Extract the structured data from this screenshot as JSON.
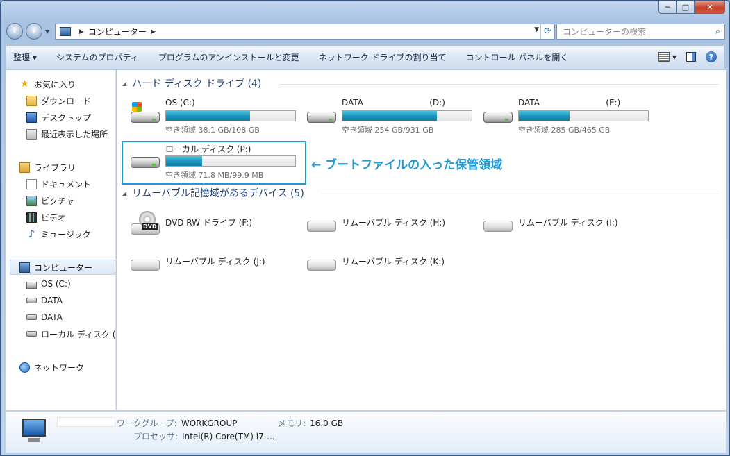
{
  "titlebar": {
    "min": "─",
    "max": "□",
    "close": "✕"
  },
  "address": {
    "crumb": "コンピューター",
    "search_placeholder": "コンピューターの検索"
  },
  "toolbar": {
    "items": [
      "整理 ▾",
      "システムのプロパティ",
      "プログラムのアンインストールと変更",
      "ネットワーク ドライブの割り当て",
      "コントロール パネルを開く"
    ]
  },
  "sidebar": {
    "favorites": "お気に入り",
    "downloads": "ダウンロード",
    "desktop": "デスクトップ",
    "recent": "最近表示した場所",
    "libraries": "ライブラリ",
    "documents": "ドキュメント",
    "pictures": "ピクチャ",
    "videos": "ビデオ",
    "music": "ミュージック",
    "computer": "コンピューター",
    "os": "OS (C:)",
    "data1": "DATA",
    "data2": "DATA",
    "local": "ローカル ディスク (",
    "network": "ネットワーク"
  },
  "groups": {
    "hdd": "ハード ディスク ドライブ (4)",
    "removable": "リムーバブル記憶域があるデバイス (5)"
  },
  "drives": [
    {
      "name": "OS (C:)",
      "free": "空き領域 38.1 GB/108 GB",
      "used": 0.65
    },
    {
      "name": "DATA                         (D:)",
      "free": "空き領域 254 GB/931 GB",
      "used": 0.73
    },
    {
      "name": "DATA                         (E:)",
      "free": "空き領域 285 GB/465 GB",
      "used": 0.39
    },
    {
      "name": "ローカル ディスク (P:)",
      "free": "空き領域 71.8 MB/99.9 MB",
      "used": 0.28
    }
  ],
  "removables": [
    "DVD RW ドライブ (F:)",
    "リムーバブル ディスク (H:)",
    "リムーバブル ディスク (I:)",
    "リムーバブル ディスク (J:)",
    "リムーバブル ディスク (K:)"
  ],
  "dvd_label": "DVD",
  "annotation": "← ブートファイルの入った保管領域",
  "status": {
    "wg_label": "ワークグループ:",
    "wg": "WORKGROUP",
    "mem_label": "メモリ:",
    "mem": "16.0 GB",
    "cpu_label": "プロセッサ:",
    "cpu": "Intel(R) Core(TM) i7-..."
  }
}
